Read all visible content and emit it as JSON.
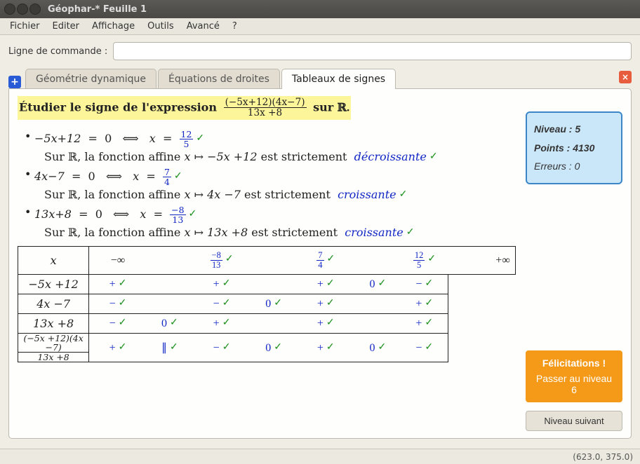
{
  "window": {
    "title": "Géophar-* Feuille 1"
  },
  "menu": {
    "items": [
      "Fichier",
      "Editer",
      "Affichage",
      "Outils",
      "Avancé",
      "?"
    ]
  },
  "command_line": {
    "label": "Ligne de commande :",
    "value": ""
  },
  "tabs": {
    "items": [
      {
        "label": "Géométrie dynamique",
        "active": false
      },
      {
        "label": "Équations de droites",
        "active": false
      },
      {
        "label": "Tableaux de signes",
        "active": true
      }
    ]
  },
  "prompt": {
    "lead": "Étudier le signe de l'expression",
    "numer": "(−5x+12)(4x−7)",
    "denom": "13x +8",
    "tail_on": "sur",
    "set": "ℝ."
  },
  "bullets": [
    {
      "eq_lhs": "−5x+12",
      "eq_root_num": "12",
      "eq_root_den": "5",
      "sub_pre": "Sur ℝ, la fonction affine",
      "map": "x ↦ −5x +12",
      "sub_post": "est strictement",
      "monotone": "décroissante"
    },
    {
      "eq_lhs": "4x−7",
      "eq_root_num": "7",
      "eq_root_den": "4",
      "sub_pre": "Sur ℝ, la fonction affine",
      "map": "x ↦ 4x −7",
      "sub_post": "est strictement",
      "monotone": "croissante"
    },
    {
      "eq_lhs": "13x+8",
      "eq_root_num": "−8",
      "eq_root_den": "13",
      "sub_pre": "Sur ℝ, la fonction affine",
      "map": "x ↦ 13x +8",
      "sub_post": "est strictement",
      "monotone": "croissante"
    }
  ],
  "table": {
    "x_label": "x",
    "minus_inf": "−∞",
    "plus_inf": "+∞",
    "roots": [
      {
        "num": "−8",
        "den": "13"
      },
      {
        "num": "7",
        "den": "4"
      },
      {
        "num": "12",
        "den": "5"
      }
    ],
    "rows": [
      {
        "label": "−5x +12",
        "cells": [
          "+",
          "",
          "+",
          "",
          "+",
          "0",
          "−"
        ]
      },
      {
        "label": "4x −7",
        "cells": [
          "−",
          "",
          "−",
          "0",
          "+",
          "",
          "+"
        ]
      },
      {
        "label": "13x +8",
        "cells": [
          "−",
          "0",
          "+",
          "",
          "+",
          "",
          "+"
        ]
      },
      {
        "label_frac": {
          "num": "(−5x +12)(4x −7)",
          "den": "13x +8"
        },
        "cells": [
          "+",
          "∥",
          "−",
          "0",
          "+",
          "0",
          "−"
        ]
      }
    ]
  },
  "score": {
    "level_label": "Niveau :",
    "level": "5",
    "points_label": "Points :",
    "points": "4130",
    "errors_label": "Erreurs :",
    "errors": "0"
  },
  "congrats": {
    "title": "Félicitations !",
    "subtitle": "Passer au niveau 6"
  },
  "next_button": {
    "label": "Niveau suivant"
  },
  "status": {
    "coords": "(623.0, 375.0)"
  }
}
